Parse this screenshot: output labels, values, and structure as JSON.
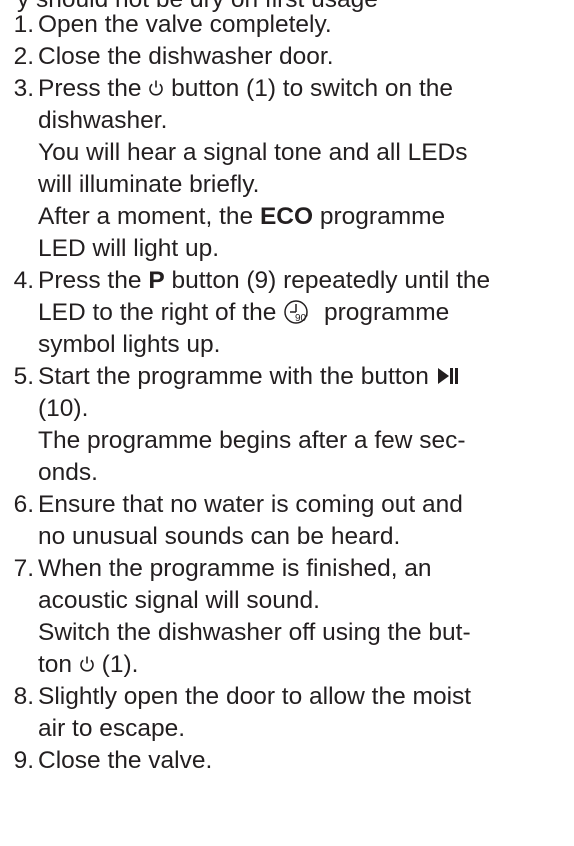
{
  "cut_text": "y should not be dry on first usage",
  "steps": [
    {
      "num": "1.",
      "lines": [
        "Open the valve completely."
      ]
    },
    {
      "num": "2.",
      "lines": [
        "Close the dishwasher door."
      ]
    },
    {
      "num": "3.",
      "pre": "Press the ",
      "icon": "power-icon",
      "post": " button (1) to switch on the",
      "lines": [
        "dishwasher.",
        "You will hear a signal tone and all LEDs",
        "will illuminate briefly.",
        "After a moment, the ",
        "ECO",
        " programme",
        "LED will light up."
      ]
    },
    {
      "num": "4.",
      "pre": "Press the ",
      "bold": "P",
      "post": " button (9) repeatedly until the",
      "l2_pre": "LED to the right of the ",
      "icon": "timer-90-icon",
      "icon_label": "90'",
      "l2_post": " programme",
      "l3": "symbol lights up."
    },
    {
      "num": "5.",
      "pre": "Start the programme with the button ",
      "icon": "play-pause-icon",
      "l2": "(10).",
      "l3": "The programme begins after a few sec-",
      "l4": "onds."
    },
    {
      "num": "6.",
      "lines": [
        "Ensure that no water is coming out and",
        "no unusual sounds can be heard."
      ]
    },
    {
      "num": "7.",
      "l1": "When the programme is finished, an",
      "l2": "acoustic signal will sound.",
      "l3": "Switch the dishwasher off using the but-",
      "l4_pre": "ton ",
      "icon": "power-icon",
      "l4_post": " (1)."
    },
    {
      "num": "8.",
      "lines": [
        "Slightly open the door to allow the moist",
        "air to escape."
      ]
    },
    {
      "num": "9.",
      "lines": [
        "Close the valve."
      ]
    }
  ]
}
